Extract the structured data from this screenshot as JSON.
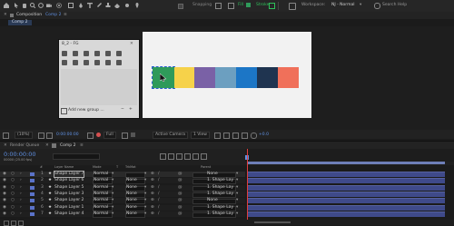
{
  "toolbar": {
    "snapping": "Snapping",
    "fill": "Fill",
    "stroke": "Stroke",
    "workspace_label": "Workspace:",
    "workspace_value": "NJ - Normal",
    "search": "Search Help"
  },
  "composition": {
    "panel_title": "Composition",
    "panel_comp": "Comp 2",
    "tab": "Comp 2"
  },
  "swatches": [
    "#2f9a5a",
    "#f6d24a",
    "#7a61a6",
    "#6c9fc0",
    "#1c76c6",
    "#1f3450",
    "#f0705a"
  ],
  "color_panel": {
    "title": "8_2 - FG",
    "add_group": "Add new group ...",
    "icon_row_1": [
      "grid",
      "plus",
      "minus",
      "arrow",
      "copy",
      "download"
    ],
    "icon_row_2": [
      "fill",
      "stroke",
      "swap",
      "layers",
      "align",
      "wave"
    ]
  },
  "viewer_bar": {
    "zoom": "(10%)",
    "timecode": "0:00:00:00",
    "quality": "Full",
    "camera": "Active Camera",
    "view": "1 View",
    "offset": "+0.0"
  },
  "timeline": {
    "tab_render": "Render Queue",
    "tab_comp": "Comp 2",
    "timecode": "0:00:00:00",
    "fps": "00000 (25.00 fps)"
  },
  "columns": {
    "num": "#",
    "layer_name": "Layer Name",
    "mode": "Mode",
    "t": "T",
    "trkmat": "TrkMat",
    "parent": "Parent"
  },
  "layers": [
    {
      "num": "1",
      "name": "Shape Layer 7",
      "mode": "Normal",
      "trkmat": "",
      "parent": "None",
      "color": "#5b73c9"
    },
    {
      "num": "2",
      "name": "Shape Layer 6",
      "mode": "Normal",
      "trkmat": "None",
      "parent": "1. Shape Lay",
      "color": "#5b73c9"
    },
    {
      "num": "3",
      "name": "Shape Layer 5",
      "mode": "Normal",
      "trkmat": "None",
      "parent": "1. Shape Lay",
      "color": "#5b73c9"
    },
    {
      "num": "4",
      "name": "Shape Layer 3",
      "mode": "Normal",
      "trkmat": "None",
      "parent": "1. Shape Lay",
      "color": "#5b73c9"
    },
    {
      "num": "5",
      "name": "Shape Layer 2",
      "mode": "Normal",
      "trkmat": "None",
      "parent": "None",
      "color": "#5b73c9"
    },
    {
      "num": "6",
      "name": "Shape Layer 1",
      "mode": "Normal",
      "trkmat": "None",
      "parent": "1. Shape Lay",
      "color": "#5b73c9"
    },
    {
      "num": "7",
      "name": "Shape Layer 4",
      "mode": "Normal",
      "trkmat": "None",
      "parent": "1. Shape Lay",
      "color": "#5b73c9"
    }
  ]
}
